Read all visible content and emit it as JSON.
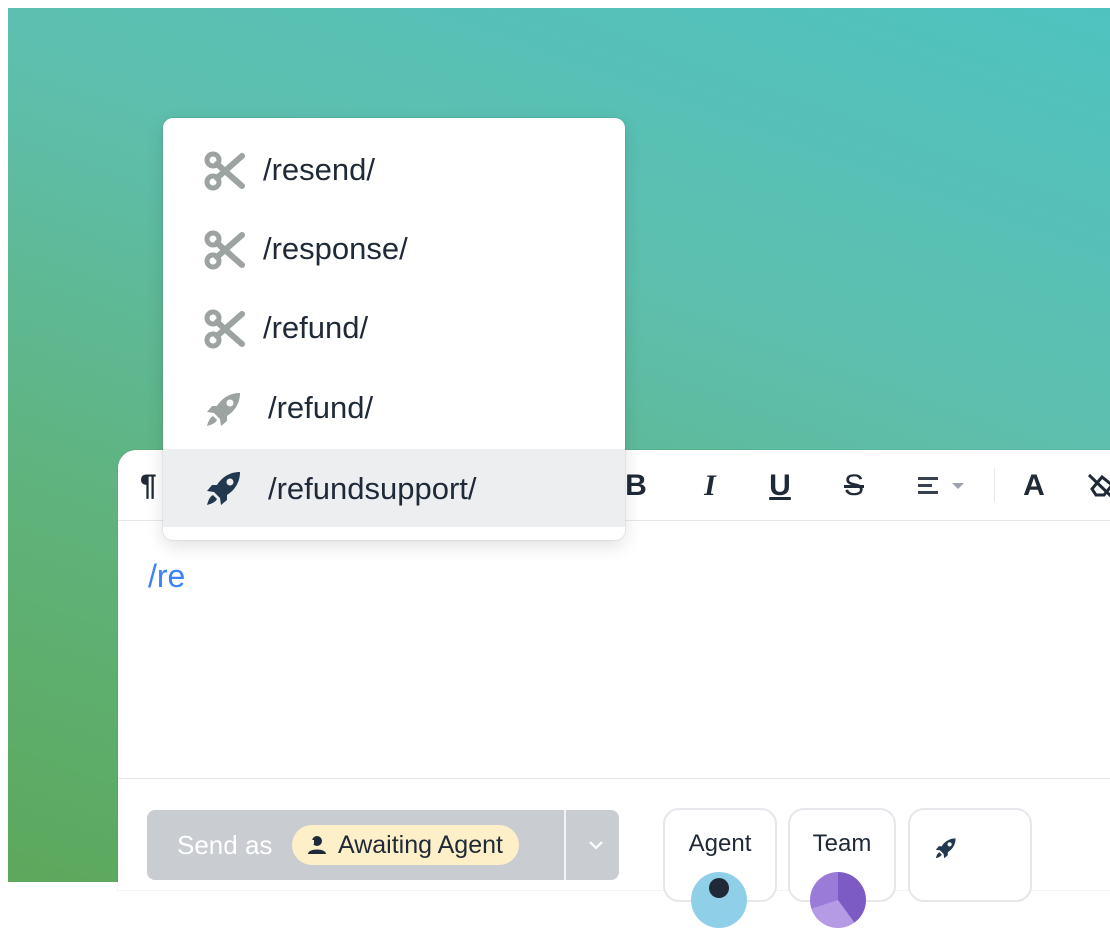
{
  "dropdown": {
    "items": [
      {
        "label": "/resend/",
        "icon": "scissors-icon"
      },
      {
        "label": "/response/",
        "icon": "scissors-icon"
      },
      {
        "label": "/refund/",
        "icon": "scissors-icon"
      },
      {
        "label": "/refund/",
        "icon": "rocket-icon"
      },
      {
        "label": "/refundsupport/",
        "icon": "rocket-icon",
        "selected": true
      }
    ]
  },
  "toolbar": {
    "paragraph": "¶",
    "bold": "B",
    "italic": "I",
    "underline": "U",
    "strike": "S",
    "font_color": "A"
  },
  "editor": {
    "typed_text": "/re"
  },
  "send": {
    "label": "Send as",
    "status": "Awaiting Agent"
  },
  "cards": {
    "agent": "Agent",
    "team": "Team"
  },
  "colors": {
    "accent": "#3b82f6",
    "status_bg": "#fdf0c8",
    "icon_dark": "#22384f",
    "icon_gray": "#9ca3a0"
  }
}
